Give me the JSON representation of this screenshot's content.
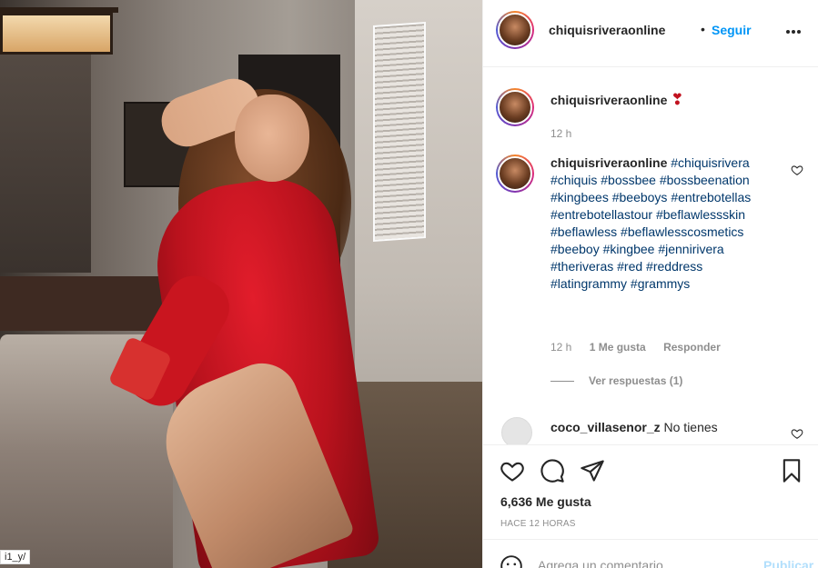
{
  "photo": {
    "corner_tag": "i1_y/"
  },
  "header": {
    "username": "chiquisriveraonline",
    "separator": "•",
    "follow_label": "Seguir"
  },
  "caption": {
    "username": "chiquisriveraonline",
    "emoji": "❣",
    "time": "12 h"
  },
  "comments": [
    {
      "username": "chiquisriveraonline",
      "text": "#chiquisrivera #chiquis #bossbee #bossbeenation #kingbees #beeboys #entrebotellas #entrebotellastour #beflawlessskin #beflawless #beflawlesscosmetics #beeboy #kingbee #jennirivera #theriveras #red #reddress #latingrammy #grammys",
      "time": "12 h",
      "likes": "1 Me gusta",
      "reply_label": "Responder",
      "view_replies": "Ver respuestas (1)"
    },
    {
      "username": "coco_villasenor_z",
      "text": "No tienes"
    }
  ],
  "actions": {
    "likes": "6,636 Me gusta",
    "timestamp": "HACE 12 HORAS"
  },
  "add_comment": {
    "placeholder": "Agrega un comentario...",
    "publish_label": "Publicar"
  },
  "colors": {
    "link_blue": "#0095f6",
    "hashtag_blue": "#00376b",
    "dress_red": "#c9151f",
    "heart_red": "#ed4956"
  }
}
